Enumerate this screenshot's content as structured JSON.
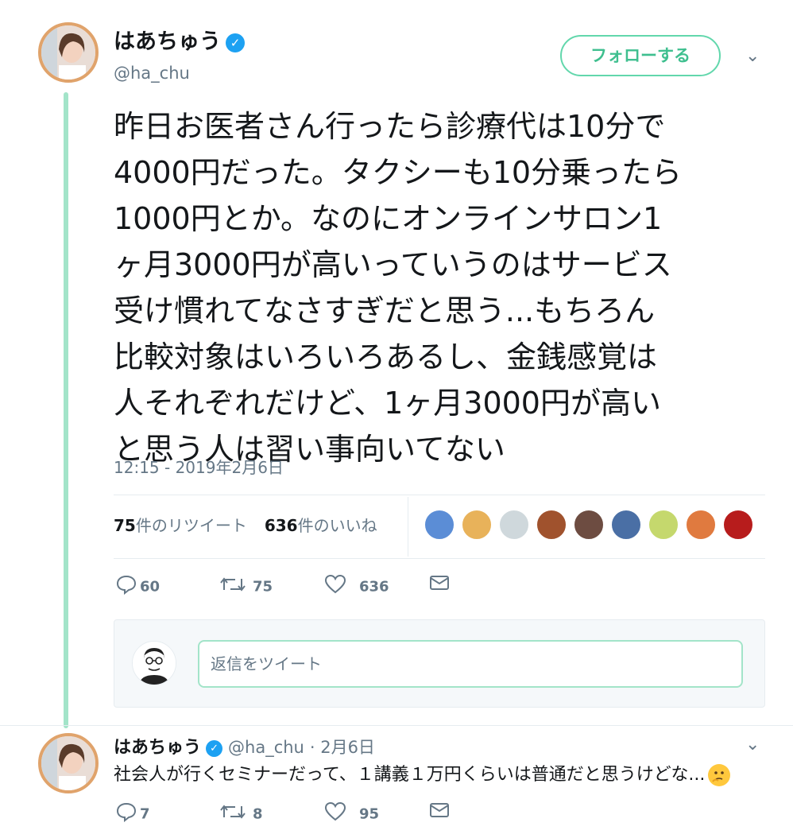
{
  "main_tweet": {
    "author": {
      "name": "はあちゅう",
      "handle": "@ha_chu"
    },
    "follow_label": "フォローする",
    "text": "昨日お医者さん行ったら診療代は10分で\n4000円だった。タクシーも10分乗ったら\n1000円とか。なのにオンラインサロン1\nヶ月3000円が高いっていうのはサービス\n受け慣れてなさすぎだと思う...もちろん\n比較対象はいろいろあるし、金銭感覚は\n人それぞれだけど、1ヶ月3000円が高い\nと思う人は習い事向いてない",
    "timestamp": "12:15 - 2019年2月6日",
    "retweets": {
      "count": "75",
      "label": "件のリツイート"
    },
    "likes": {
      "count": "636",
      "label": "件のいいね"
    },
    "liker_colors": [
      "#5b8dd6",
      "#e8b25a",
      "#cfd8dc",
      "#a0522d",
      "#6d4c41",
      "#4a6fa5",
      "#c5d86d",
      "#e07a3f",
      "#b71c1c"
    ],
    "actions": {
      "reply": "60",
      "retweet": "75",
      "like": "636"
    }
  },
  "reply_composer": {
    "placeholder": "返信をツイート"
  },
  "reply_tweet": {
    "author": {
      "name": "はあちゅう",
      "handle": "@ha_chu",
      "date": "· 2月6日"
    },
    "text": "社会人が行くセミナーだって、１講義１万円くらいは普通だと思うけどな...",
    "emoji": "thinking-face",
    "actions": {
      "reply": "7",
      "retweet": "8",
      "like": "95"
    }
  },
  "colors": {
    "accent": "#3fbf8f",
    "thread_line": "#a3e4c9",
    "verified": "#1da1f2",
    "muted": "#657786"
  }
}
